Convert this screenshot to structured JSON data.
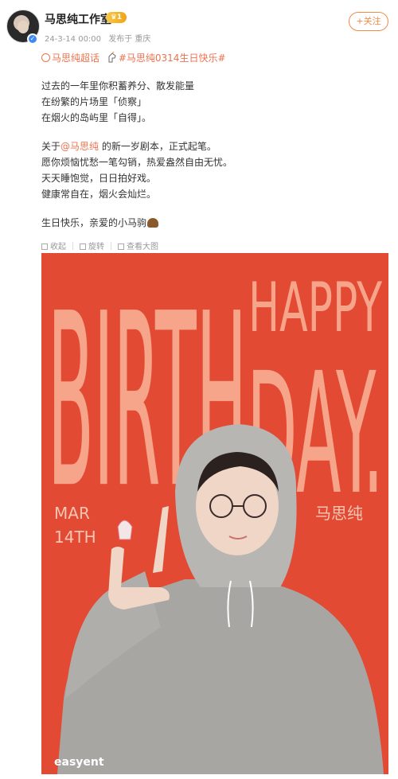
{
  "header": {
    "name": "马思纯工作室",
    "vip_level": "♛1",
    "time": "24-3-14 00:00",
    "source": "发布于 重庆",
    "follow_label": "+关注"
  },
  "tags": {
    "supertopic": "马思纯超话",
    "hashtag": "#马思纯0314生日快乐#"
  },
  "post": {
    "line1": "过去的一年里你积蓄养分、散发能量",
    "line2": "在纷繁的片场里「侦察」",
    "line3": "在烟火的岛屿里「自得」。",
    "line4_prefix": "关于",
    "line4_mention": "@马思纯",
    "line4_suffix": " 的新一岁剧本，正式起笔。",
    "line5": "愿你烦恼忧愁一笔勾销，热爱盎然自由无忧。",
    "line6": "天天睡饱觉，日日拍好戏。",
    "line7": "健康常自在，烟火会灿烂。",
    "line8": "生日快乐，亲爱的小马驹"
  },
  "toolbar": {
    "collapse": "收起",
    "rotate": "旋转",
    "view_large": "查看大图"
  },
  "poster": {
    "birth": "BIRTH",
    "happy": "HAPPY",
    "day": "DAY.",
    "date_month": "MAR",
    "date_day": "14TH",
    "name": "马思纯",
    "watermark": "easyent"
  },
  "colors": {
    "accent": "#eb7350",
    "poster_bg": "#e24a34",
    "poster_text": "#f7a58a",
    "follow": "#f28a48"
  }
}
